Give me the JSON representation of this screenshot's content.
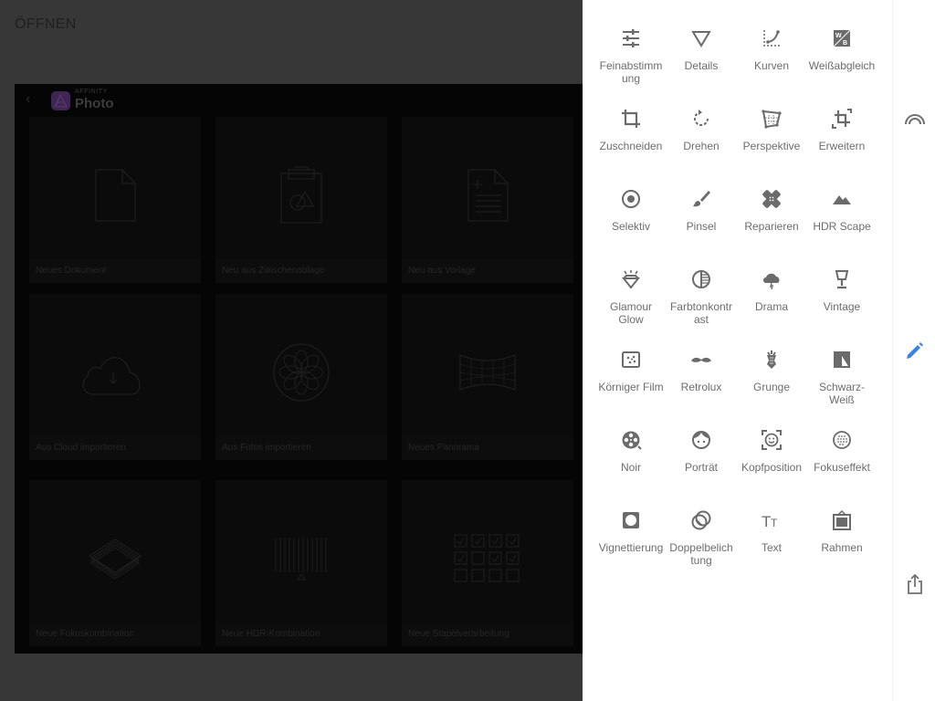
{
  "page": {
    "title": "ÖFFNEN"
  },
  "app": {
    "brand_small": "AFFINITY",
    "brand_name": "Photo",
    "back_icon": "chevron-left-icon",
    "tiles": [
      {
        "label": "Neues Dokument",
        "icon": "document-icon"
      },
      {
        "label": "Neu aus Zwischenablage",
        "icon": "clipboard-icon"
      },
      {
        "label": "Neu aus Vorlage",
        "icon": "template-document-icon"
      },
      {
        "label": "Aus Cloud importieren",
        "icon": "cloud-download-icon"
      },
      {
        "label": "Aus Fotos importieren",
        "icon": "photos-flower-icon"
      },
      {
        "label": "Neues Panorama",
        "icon": "panorama-grid-icon"
      },
      {
        "label": "Neue Fokuskombination",
        "icon": "focus-stack-icon"
      },
      {
        "label": "Neue HDR-Kombination",
        "icon": "hdr-bars-icon"
      },
      {
        "label": "Neue Stapelverarbeitung",
        "icon": "batch-checkbox-grid-icon"
      }
    ]
  },
  "tools_panel": {
    "tools": [
      {
        "label": "Feinabstimmung",
        "line1": "Feinabstimm",
        "line2": "ung",
        "icon": "tune-sliders-icon"
      },
      {
        "label": "Details",
        "line1": "Details",
        "line2": "",
        "icon": "details-triangle-icon"
      },
      {
        "label": "Kurven",
        "line1": "Kurven",
        "line2": "",
        "icon": "curves-icon"
      },
      {
        "label": "Weißabgleich",
        "line1": "Weißabgleich",
        "line2": "",
        "icon": "white-balance-icon"
      },
      {
        "label": "Zuschneiden",
        "line1": "Zuschneiden",
        "line2": "",
        "icon": "crop-icon"
      },
      {
        "label": "Drehen",
        "line1": "Drehen",
        "line2": "",
        "icon": "rotate-icon"
      },
      {
        "label": "Perspektive",
        "line1": "Perspektive",
        "line2": "",
        "icon": "perspective-icon"
      },
      {
        "label": "Erweitern",
        "line1": "Erweitern",
        "line2": "",
        "icon": "expand-crop-icon"
      },
      {
        "label": "Selektiv",
        "line1": "Selektiv",
        "line2": "",
        "icon": "selective-target-icon"
      },
      {
        "label": "Pinsel",
        "line1": "Pinsel",
        "line2": "",
        "icon": "brush-icon"
      },
      {
        "label": "Reparieren",
        "line1": "Reparieren",
        "line2": "",
        "icon": "healing-bandage-icon"
      },
      {
        "label": "HDR Scape",
        "line1": "HDR Scape",
        "line2": "",
        "icon": "mountains-icon"
      },
      {
        "label": "Glamour Glow",
        "line1": "Glamour",
        "line2": "Glow",
        "icon": "diamond-glow-icon"
      },
      {
        "label": "Farbtonkontrast",
        "line1": "Farbtonkontr",
        "line2": "ast",
        "icon": "tonal-contrast-icon"
      },
      {
        "label": "Drama",
        "line1": "Drama",
        "line2": "",
        "icon": "storm-cloud-icon"
      },
      {
        "label": "Vintage",
        "line1": "Vintage",
        "line2": "",
        "icon": "lamp-icon"
      },
      {
        "label": "Körniger Film",
        "line1": "Körniger Film",
        "line2": "",
        "icon": "grainy-film-icon"
      },
      {
        "label": "Retrolux",
        "line1": "Retrolux",
        "line2": "",
        "icon": "mustache-icon"
      },
      {
        "label": "Grunge",
        "line1": "Grunge",
        "line2": "",
        "icon": "guitar-icon"
      },
      {
        "label": "Schwarz-Weiß",
        "line1": "Schwarz-",
        "line2": "Weiß",
        "icon": "black-white-icon"
      },
      {
        "label": "Noir",
        "line1": "Noir",
        "line2": "",
        "icon": "film-reel-icon"
      },
      {
        "label": "Porträt",
        "line1": "Porträt",
        "line2": "",
        "icon": "face-icon"
      },
      {
        "label": "Kopfposition",
        "line1": "Kopfposition",
        "line2": "",
        "icon": "face-frame-icon"
      },
      {
        "label": "Fokuseffekt",
        "line1": "Fokuseffekt",
        "line2": "",
        "icon": "focus-effect-icon"
      },
      {
        "label": "Vignettierung",
        "line1": "Vignettierung",
        "line2": "",
        "icon": "vignette-icon"
      },
      {
        "label": "Doppelbelichtung",
        "line1": "Doppelbelich",
        "line2": "tung",
        "icon": "double-exposure-icon"
      },
      {
        "label": "Text",
        "line1": "Text",
        "line2": "",
        "icon": "text-icon"
      },
      {
        "label": "Rahmen",
        "line1": "Rahmen",
        "line2": "",
        "icon": "frame-icon"
      }
    ]
  },
  "side_rail": {
    "items": [
      {
        "icon": "looks-arc-icon",
        "active": false
      },
      {
        "icon": "edit-pencil-icon",
        "active": true
      },
      {
        "icon": "share-icon",
        "active": false
      }
    ],
    "active_color": "#3b82e6",
    "inactive_color": "#707070"
  }
}
